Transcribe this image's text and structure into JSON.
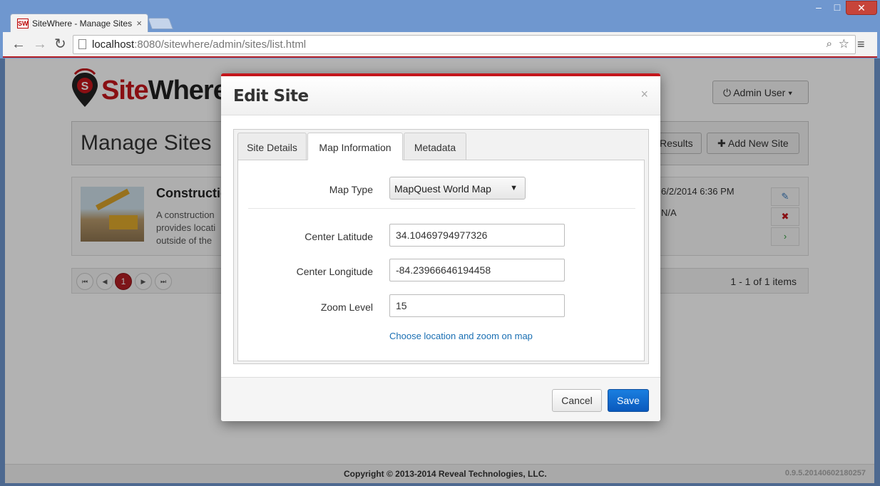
{
  "browser": {
    "tab_title": "SiteWhere - Manage Sites",
    "favicon_text": "SW",
    "url_host": "localhost",
    "url_rest": ":8080/sitewhere/admin/sites/list.html",
    "icons": [
      "back-arrow-icon",
      "forward-arrow-icon",
      "reload-icon",
      "zoom-icon",
      "star-icon",
      "menu-icon"
    ]
  },
  "header": {
    "logo_site": "Site",
    "logo_where": "Where",
    "user_button": "Admin User"
  },
  "titlebar": {
    "title": "Manage Sites",
    "results_button": "Results",
    "add_button": "Add New Site"
  },
  "site": {
    "name": "Construction",
    "description": "A construction provides locati outside of the",
    "date": "6/2/2014 6:36 PM",
    "updated": "N/A"
  },
  "pager": {
    "current_page": "1",
    "count": "1 - 1 of 1 items"
  },
  "footer": {
    "copyright": "Copyright © 2013-2014 Reveal Technologies, LLC.",
    "version": "0.9.5.20140602180257"
  },
  "modal": {
    "title": "Edit Site",
    "close": "×",
    "tabs": [
      {
        "label": "Site Details"
      },
      {
        "label": "Map Information",
        "active": true
      },
      {
        "label": "Metadata"
      }
    ],
    "map_type_label": "Map Type",
    "map_type_value": "MapQuest World Map",
    "lat_label": "Center Latitude",
    "lat_value": "34.10469794977326",
    "lng_label": "Center Longitude",
    "lng_value": "-84.23966646194458",
    "zoom_label": "Zoom Level",
    "zoom_value": "15",
    "map_link": "Choose location and zoom on map",
    "cancel_button": "Cancel",
    "save_button": "Save"
  },
  "colors": {
    "brand_red": "#c4161c",
    "primary_blue": "#0a59bd",
    "link_blue": "#1a6fb3"
  }
}
